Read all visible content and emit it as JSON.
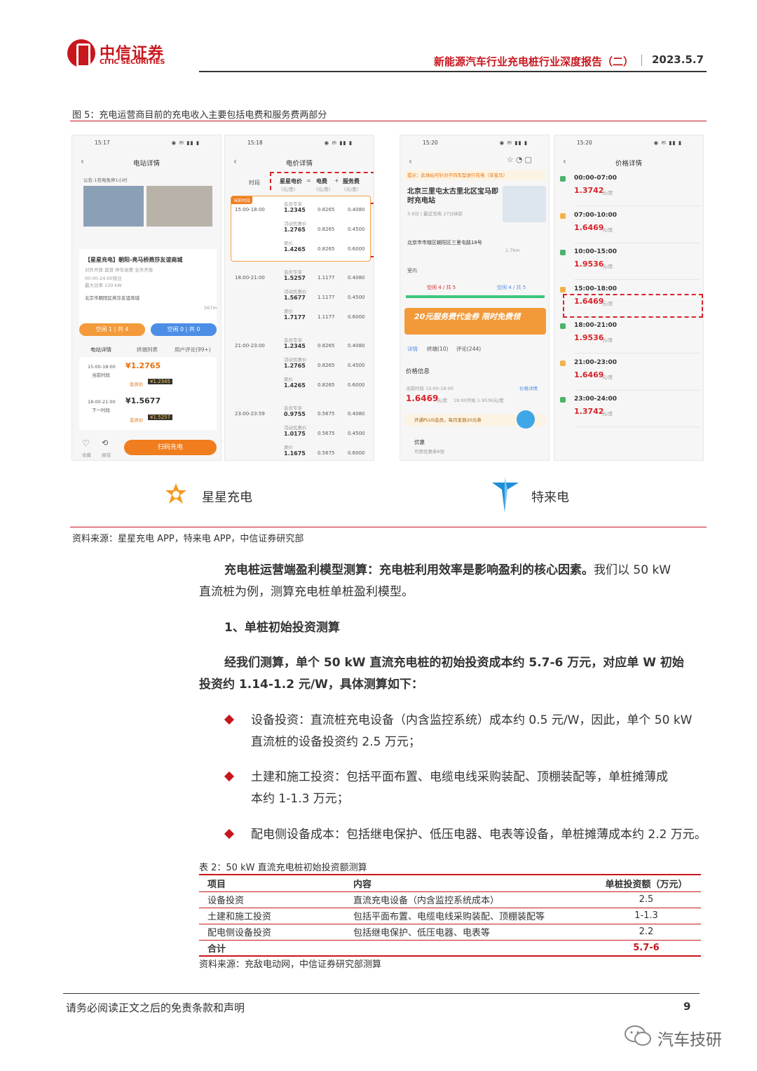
{
  "header": {
    "logo_cn": "中信证券",
    "logo_en": "CITIC SECURITIES",
    "report_title": "新能源汽车行业充电桩行业深度报告（二）",
    "date": "2023.5.7"
  },
  "figure": {
    "caption": "图 5：充电运营商目前的充电收入主要包括电费和服务费两部分",
    "source": "资料来源：星星充电 APP，特来电 APP，中信证券研究部",
    "brand_left": "星星充电",
    "brand_right": "特来电",
    "phone1": {
      "time": "15:17",
      "title": "电站详情",
      "notice": "公告:1充电免停1小时",
      "station": "【星星充电】朝阳-亮马桥燕莎友谊商城",
      "tags": "对外开放   直营   停车收费   全天开放",
      "hours": "00:00-24:00营业",
      "power": "最大功率 120 kW",
      "address": "北京市朝阳区燕莎友谊商城",
      "distance": "567m",
      "free1": "空闲 1 | 共 4",
      "free2": "空闲 0 | 共 0",
      "tabs": [
        "电站详情",
        "终端列表",
        "用户评论(99+)"
      ],
      "slot1_time": "15:00-18:00",
      "slot1_label": "当前时段",
      "slot1_price": "¥1.2765",
      "slot1_member": "¥1.2345",
      "slot2_time": "18:00-21:00",
      "slot2_label": "下一时段",
      "slot2_price": "¥1.5677",
      "slot2_member": "¥1.5257",
      "member_tag": "会员价",
      "fav": "收藏",
      "report": "报错",
      "scan_btn": "扫码充电"
    },
    "phone2": {
      "time": "15:18",
      "title": "电价详情",
      "col_period": "时段",
      "col_price": "星星电价",
      "col_eq": "=",
      "col_elec": "电费",
      "col_plus": "+",
      "col_service": "服务费",
      "unit": "(元/度)",
      "current_tag": "当前时段",
      "rows": [
        {
          "period": "15:00-18:00",
          "prices": [
            "1.2345",
            "1.2765",
            "1.4265"
          ],
          "elec": [
            "0.8265",
            "0.8265",
            "0.8265"
          ],
          "service": [
            "0.4080",
            "0.4500",
            "0.6000"
          ]
        },
        {
          "period": "18:00-21:00",
          "prices": [
            "1.5257",
            "1.5677",
            "1.7177"
          ],
          "elec": [
            "1.1177",
            "1.1177",
            "1.1177"
          ],
          "service": [
            "0.4080",
            "0.4500",
            "0.6000"
          ]
        },
        {
          "period": "21:00-23:00",
          "prices": [
            "1.2345",
            "1.2765",
            "1.4265"
          ],
          "elec": [
            "0.8265",
            "0.8265",
            "0.8265"
          ],
          "service": [
            "0.4080",
            "0.4500",
            "0.6000"
          ]
        },
        {
          "period": "23:00-23:59",
          "prices": [
            "0.9755",
            "1.0175",
            "1.1675"
          ],
          "elec": [
            "0.5675",
            "0.5675",
            "0.5675"
          ],
          "service": [
            "0.4080",
            "0.4500",
            "0.6000"
          ]
        }
      ],
      "tier_labels": [
        "会员专享",
        "活动优惠价",
        "原价"
      ]
    },
    "phone3": {
      "time": "15:20",
      "notice": "提示：此场站可针对不同车型进行充电（非宝马）",
      "station": "北京三里屯太古里北区宝马即时充电站",
      "rating": "3.9分 | 最近充电 27分钟前",
      "address": "北京市市辖区朝阳区三里屯路18号",
      "distance": "1.7km",
      "indoor": "室内",
      "slow": "空闲 4 / 共 5",
      "fast": "空闲 4 / 共 5",
      "coupon": "20元服务费代金券 限时免费领",
      "tabs": [
        "详情",
        "终端(10)",
        "评论(244)"
      ],
      "price_info": "价格信息",
      "current_period": "当前时段 15:00-18:00",
      "price_detail": "价格详情",
      "current_price": "1.6469",
      "price_unit": "元/度",
      "next_hint": "18:00开始 1.9536元/度",
      "plus": "开通PLUS会员，每月发放20元券",
      "promo": "优惠",
      "promo_sub": "可用优惠券8张"
    },
    "phone4": {
      "time": "15:20",
      "title": "价格详情",
      "unit": "元/度",
      "slots": [
        {
          "time": "00:00-07:00",
          "price": "1.3742"
        },
        {
          "time": "07:00-10:00",
          "price": "1.6469"
        },
        {
          "time": "10:00-15:00",
          "price": "1.9536"
        },
        {
          "time": "15:00-18:00",
          "price": "1.6469"
        },
        {
          "time": "18:00-21:00",
          "price": "1.9536"
        },
        {
          "time": "21:00-23:00",
          "price": "1.6469"
        },
        {
          "time": "23:00-24:00",
          "price": "1.3742"
        }
      ]
    }
  },
  "body": {
    "p1_bold": "充电桩运营端盈利模型测算：充电桩利用效率是影响盈利的核心因素。",
    "p1_rest_a": "我们以 50 kW",
    "p1_rest_b": "直流桩为例，测算充电桩单桩盈利模型。",
    "h1": "1、单桩初始投资测算",
    "p2_a": "经我们测算，单个 50  kW 直流充电桩的初始投资成本约 5.7-6 万元，对应单 W 初始",
    "p2_b": "投资约 1.14-1.2 元/W，具体测算如下：",
    "b1_a": "设备投资：直流桩充电设备（内含监控系统）成本约 0.5 元/W，因此，单个 50 kW",
    "b1_b": "直流桩的设备投资约 2.5 万元；",
    "b2_a": "土建和施工投资：包括平面布置、电缆电线采购装配、顶棚装配等，单桩摊薄成",
    "b2_b": "本约 1-1.3 万元；",
    "b3_a": "配电侧设备成本：包括继电保护、低压电器、电表等设备，单桩摊薄成本约 2.2 万元。"
  },
  "table": {
    "caption": "表 2：50 kW 直流充电桩初始投资额测算",
    "headers": [
      "项目",
      "内容",
      "单桩投资额（万元）"
    ],
    "rows": [
      [
        "设备投资",
        "直流充电设备（内含监控系统成本）",
        "2.5"
      ],
      [
        "土建和施工投资",
        "包括平面布置、电缆电线采购装配、顶棚装配等",
        "1-1.3"
      ],
      [
        "配电侧设备投资",
        "包括继电保护、低压电器、电表等",
        "2.2"
      ]
    ],
    "total": [
      "合计",
      "",
      "5.7-6"
    ],
    "source": "资料来源：充敌电动网，中信证券研究部测算"
  },
  "footer": {
    "disclaimer": "请务必阅读正文之后的免责条款和声明",
    "page": "9",
    "watermark": "汽车技研"
  },
  "colors": {
    "brand_red": "#c8161d",
    "accent_orange": "#e8710a",
    "price_red": "#d6242a",
    "teld_blue": "#1e8fd8"
  },
  "icons": {
    "logo": "citic-logo-icon",
    "watermark": "wechat-icon",
    "star_charge": "star-charge-logo-icon",
    "teld": "teld-logo-icon"
  }
}
